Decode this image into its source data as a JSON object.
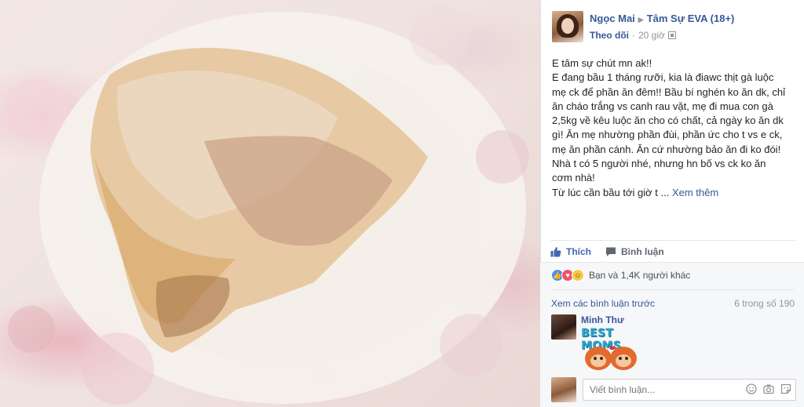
{
  "post": {
    "author": "Ngọc Mai",
    "group": "Tâm Sự EVA (18+)",
    "follow_label": "Theo dõi",
    "time": "20 giờ",
    "text_lines": [
      "E tâm sự chút mn ak!!",
      "E đang bầu 1 tháng rưỡi, kia là điawc thịt gà luộc",
      "mẹ ck để phần ăn đêm!! Bầu bí nghén ko ăn dk, chỉ",
      "ăn cháo trắng vs canh rau vặt, mẹ đi mua con gà",
      "2,5kg về kêu luộc ăn cho có chất, cả ngày ko ăn dk",
      "gì! Ăn mẹ nhường phần đùi, phần ức cho t vs e ck,",
      "mẹ ăn phần cánh. Ăn cứ nhường bảo ăn đi ko đói!",
      "Nhà t có 5 người nhé, nhưng hn bố vs ck ko ăn",
      "cơm nhà!",
      "Từ lúc cần bầu tới giờ t ..."
    ],
    "see_more": "Xem thêm"
  },
  "actions": {
    "like_label": "Thích",
    "comment_label": "Bình luận"
  },
  "reactions": {
    "summary": "Bạn và 1,4K người khác",
    "icons": [
      "like-icon",
      "love-icon",
      "haha-icon"
    ]
  },
  "comments": {
    "prev_label": "Xem các bình luận trước",
    "count_label": "6 trong số 190",
    "items": [
      {
        "name": "Minh Thư",
        "sticker_text": "BEST MOMS"
      }
    ],
    "write_placeholder": "Viết bình luận..."
  },
  "colors": {
    "link": "#365899",
    "like_blue": "#4267b2",
    "muted": "#90949c"
  }
}
